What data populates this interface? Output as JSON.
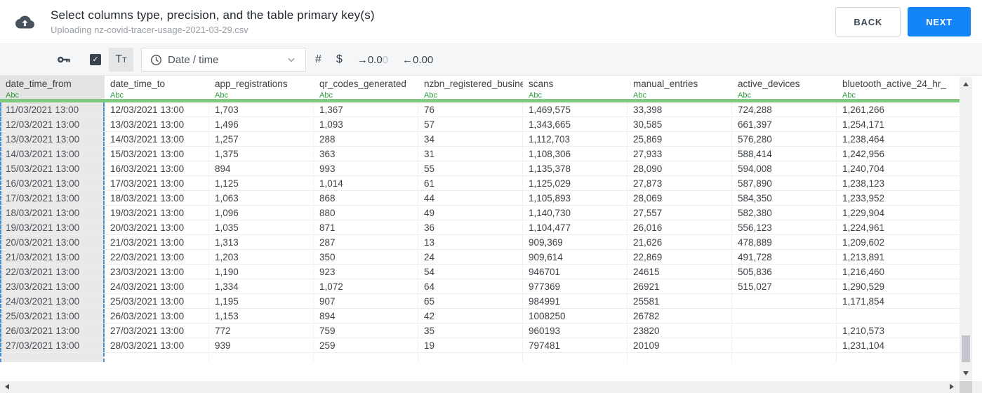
{
  "header": {
    "title": "Select columns type, precision, and the table primary key(s)",
    "subtitle": "Uploading nz-covid-tracer-usage-2021-03-29.csv",
    "back_label": "BACK",
    "next_label": "NEXT"
  },
  "toolbar": {
    "checkbox_checked": true,
    "checkmark": "✓",
    "text_type_label": "Tt",
    "type_value": "Date / time",
    "number_label": "#",
    "currency_label": "$",
    "increase_precision": {
      "arrow": "→",
      "value": "0.0",
      "ghost": "0"
    },
    "decrease_precision": {
      "arrow": "←",
      "value": "0.00"
    }
  },
  "colors": {
    "accent_blue": "#1285f8",
    "selection_dashed_blue": "#4a90d6",
    "type_green": "#2f9e3f",
    "header_underline_green": "#80c980"
  },
  "table": {
    "type_badge": "Abc",
    "selected_column_index": 0,
    "columns": [
      "date_time_from",
      "date_time_to",
      "app_registrations",
      "qr_codes_generated",
      "nzbn_registered_busine",
      "scans",
      "manual_entries",
      "active_devices",
      "bluetooth_active_24_hr_"
    ],
    "rows": [
      [
        "11/03/2021 13:00",
        "12/03/2021 13:00",
        "1,703",
        "1,367",
        "76",
        "1,469,575",
        "33,398",
        "724,288",
        "1,261,266"
      ],
      [
        "12/03/2021 13:00",
        "13/03/2021 13:00",
        "1,496",
        "1,093",
        "57",
        "1,343,665",
        "30,585",
        "661,397",
        "1,254,171"
      ],
      [
        "13/03/2021 13:00",
        "14/03/2021 13:00",
        "1,257",
        "288",
        "34",
        "1,112,703",
        "25,869",
        "576,280",
        "1,238,464"
      ],
      [
        "14/03/2021 13:00",
        "15/03/2021 13:00",
        "1,375",
        "363",
        "31",
        "1,108,306",
        "27,933",
        "588,414",
        "1,242,956"
      ],
      [
        "15/03/2021 13:00",
        "16/03/2021 13:00",
        "894",
        "993",
        "55",
        "1,135,378",
        "28,090",
        "594,008",
        "1,240,704"
      ],
      [
        "16/03/2021 13:00",
        "17/03/2021 13:00",
        "1,125",
        "1,014",
        "61",
        "1,125,029",
        "27,873",
        "587,890",
        "1,238,123"
      ],
      [
        "17/03/2021 13:00",
        "18/03/2021 13:00",
        "1,063",
        "868",
        "44",
        "1,105,893",
        "28,069",
        "584,350",
        "1,233,952"
      ],
      [
        "18/03/2021 13:00",
        "19/03/2021 13:00",
        "1,096",
        "880",
        "49",
        "1,140,730",
        "27,557",
        "582,380",
        "1,229,904"
      ],
      [
        "19/03/2021 13:00",
        "20/03/2021 13:00",
        "1,035",
        "871",
        "36",
        "1,104,477",
        "26,016",
        "556,123",
        "1,224,961"
      ],
      [
        "20/03/2021 13:00",
        "21/03/2021 13:00",
        "1,313",
        "287",
        "13",
        "909,369",
        "21,626",
        "478,889",
        "1,209,602"
      ],
      [
        "21/03/2021 13:00",
        "22/03/2021 13:00",
        "1,203",
        "350",
        "24",
        "909,614",
        "22,869",
        "491,728",
        "1,213,891"
      ],
      [
        "22/03/2021 13:00",
        "23/03/2021 13:00",
        "1,190",
        "923",
        "54",
        "946701",
        "24615",
        "505,836",
        "1,216,460"
      ],
      [
        "23/03/2021 13:00",
        "24/03/2021 13:00",
        "1,334",
        "1,072",
        "64",
        "977369",
        "26921",
        "515,027",
        "1,290,529"
      ],
      [
        "24/03/2021 13:00",
        "25/03/2021 13:00",
        "1,195",
        "907",
        "65",
        "984991",
        "25581",
        "",
        "1,171,854"
      ],
      [
        "25/03/2021 13:00",
        "26/03/2021 13:00",
        "1,153",
        "894",
        "42",
        "1008250",
        "26782",
        "",
        ""
      ],
      [
        "26/03/2021 13:00",
        "27/03/2021 13:00",
        "772",
        "759",
        "35",
        "960193",
        "23820",
        "",
        "1,210,573"
      ],
      [
        "27/03/2021 13:00",
        "28/03/2021 13:00",
        "939",
        "259",
        "19",
        "797481",
        "20109",
        "",
        "1,231,104"
      ]
    ]
  }
}
